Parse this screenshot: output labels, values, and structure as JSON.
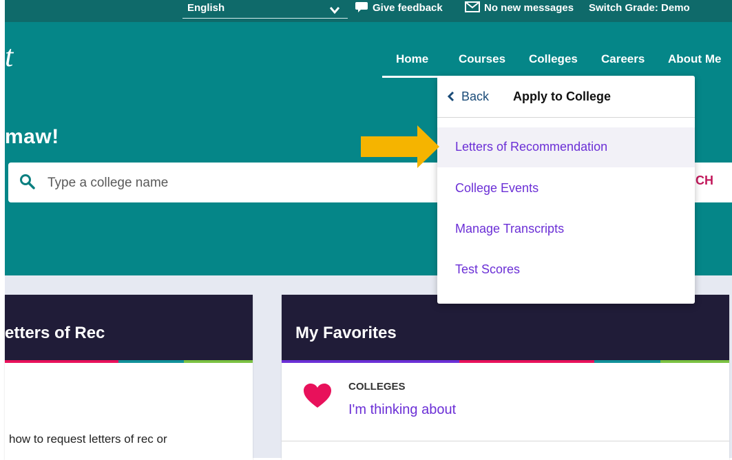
{
  "topbar": {
    "language": "English",
    "feedback_label": "Give feedback",
    "messages_label": "No new messages",
    "switch_grade_label": "Switch Grade:",
    "grade_value": "Demo"
  },
  "logo_fragment": "t",
  "nav": {
    "items": [
      {
        "label": "Home",
        "active": true
      },
      {
        "label": "Courses"
      },
      {
        "label": "Colleges"
      },
      {
        "label": "Careers"
      },
      {
        "label": "About Me"
      }
    ]
  },
  "hero": {
    "greeting": "maw!"
  },
  "search": {
    "placeholder": "Type a college name",
    "button_label": "CH"
  },
  "dropdown": {
    "back_label": "Back",
    "title": "Apply to College",
    "items": [
      {
        "label": "Letters of Recommendation",
        "highlighted": true
      },
      {
        "label": "College Events"
      },
      {
        "label": "Manage Transcripts"
      },
      {
        "label": "Test Scores"
      }
    ]
  },
  "card_letters": {
    "title": "etters of Rec",
    "body": "how to request letters of rec or"
  },
  "card_favorites": {
    "title": "My Favorites",
    "category": "COLLEGES",
    "link": "I'm thinking about"
  },
  "colors": {
    "topbar": "#0f6a6a",
    "hero": "#058688",
    "card_header": "#201c38",
    "link_purple": "#6b2fd6",
    "accent_pink": "#e8115b",
    "accent_teal": "#11919a",
    "accent_green": "#7bc142",
    "arrow": "#f5b400"
  }
}
